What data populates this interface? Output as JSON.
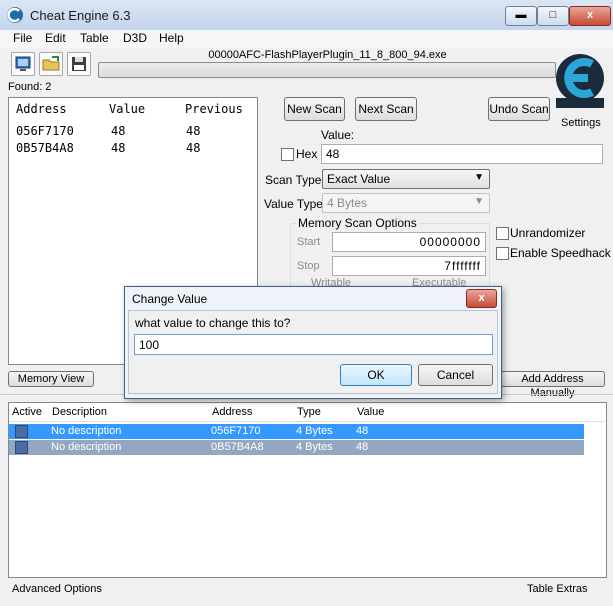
{
  "window": {
    "title": "Cheat Engine 6.3",
    "close_glyph": "x"
  },
  "menu": [
    "File",
    "Edit",
    "Table",
    "D3D",
    "Help"
  ],
  "toolbar": {
    "process_name": "00000AFC-FlashPlayerPlugin_11_8_800_94.exe",
    "icons": [
      "open-process-icon",
      "open-file-icon",
      "save-icon"
    ]
  },
  "logo": {
    "settings_label": "Settings"
  },
  "found_label": "Found: 2",
  "results": {
    "headers": [
      "Address",
      "Value",
      "Previous"
    ],
    "rows": [
      [
        "056F7170",
        "48",
        "48"
      ],
      [
        "0B57B4A8",
        "48",
        "48"
      ]
    ]
  },
  "scan": {
    "new_scan": "New Scan",
    "next_scan": "Next Scan",
    "undo_scan": "Undo Scan",
    "value_label": "Value:",
    "hex_label": "Hex",
    "value": "48",
    "scan_type_label": "Scan Type",
    "scan_type": "Exact Value",
    "value_type_label": "Value Type",
    "value_type": "4 Bytes",
    "memory_options_label": "Memory Scan Options",
    "start_label": "Start",
    "start_value": "00000000",
    "stop_label": "Stop",
    "stop_value": "7fffffff",
    "writable_label": "Writable",
    "executable_label": "Executable",
    "unrandomizer_label": "Unrandomizer",
    "speedhack_label": "Enable Speedhack"
  },
  "memory_view_button": "Memory View",
  "add_manual_button": "Add Address Manually",
  "address_list": {
    "headers": [
      "Active",
      "Description",
      "Address",
      "Type",
      "Value"
    ],
    "rows": [
      {
        "description": "No description",
        "address": "056F7170",
        "type": "4 Bytes",
        "value": "48",
        "color": "#3399ff"
      },
      {
        "description": "No description",
        "address": "0B57B4A8",
        "type": "4 Bytes",
        "value": "48",
        "color": "#94a6c0"
      }
    ]
  },
  "status": {
    "left": "Advanced Options",
    "right": "Table Extras"
  },
  "dialog": {
    "title": "Change Value",
    "prompt": "what value to change this to?",
    "input_value": "100",
    "ok": "OK",
    "cancel": "Cancel"
  }
}
